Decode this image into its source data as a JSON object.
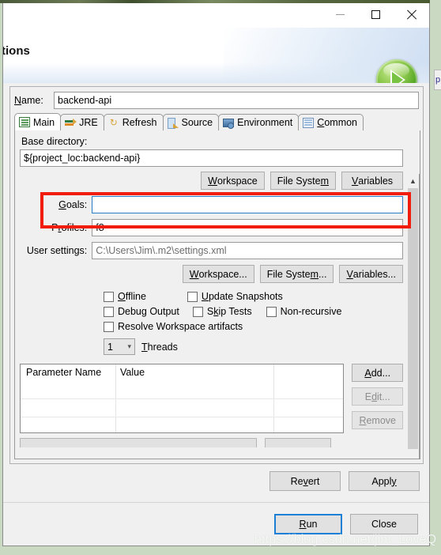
{
  "window": {
    "title_clipped": "onfigurations",
    "minimize": "—",
    "maximize": "□",
    "close": "✕",
    "run_icon": "run-play-orb"
  },
  "name_row": {
    "label": "Name:",
    "label_mnemonic": "N",
    "value": "backend-api"
  },
  "tabs": [
    {
      "label": "Main",
      "icon": "main-document-icon",
      "active": true
    },
    {
      "label": "JRE",
      "icon": "jre-library-icon",
      "active": false
    },
    {
      "label": "Refresh",
      "icon": "refresh-arrows-icon",
      "active": false
    },
    {
      "label": "Source",
      "icon": "source-lookup-icon",
      "active": false
    },
    {
      "label": "Environment",
      "icon": "environment-monitor-icon",
      "active": false
    },
    {
      "label": "Common",
      "icon": "common-table-icon",
      "active": false
    }
  ],
  "main_tab": {
    "base_directory": {
      "label": "Base directory:",
      "value": "${project_loc:backend-api}"
    },
    "dir_buttons": [
      "Workspace",
      "File System",
      "Variables"
    ],
    "goals": {
      "label": "Goals:",
      "value": "",
      "focused": true
    },
    "profiles": {
      "label": "Profiles:",
      "value": "f8"
    },
    "user_settings": {
      "label": "User settings:",
      "value": "C:\\Users\\Jim\\.m2\\settings.xml"
    },
    "settings_buttons": [
      "Workspace...",
      "File System...",
      "Variables..."
    ],
    "checkboxes": [
      {
        "label": "Offline",
        "checked": false
      },
      {
        "label": "Update Snapshots",
        "checked": false
      },
      {
        "label": "Debug Output",
        "checked": false
      },
      {
        "label": "Skip Tests",
        "checked": false
      },
      {
        "label": "Non-recursive",
        "checked": false
      },
      {
        "label": "Resolve Workspace artifacts",
        "checked": false
      }
    ],
    "threads": {
      "value": "1",
      "label": "Threads"
    },
    "parameters_table": {
      "columns": [
        "Parameter Name",
        "Value"
      ],
      "rows": []
    },
    "table_buttons": [
      {
        "label": "Add...",
        "enabled": true
      },
      {
        "label": "Edit...",
        "enabled": false
      },
      {
        "label": "Remove",
        "enabled": false
      }
    ]
  },
  "footer": {
    "revert": "Revert",
    "apply": "Apply",
    "run": "Run",
    "close": "Close"
  },
  "annotation": {
    "target": "goals-field",
    "color": "#f21c0d"
  },
  "watermark": "https://blog.csdn.net/jim_LoveQ"
}
